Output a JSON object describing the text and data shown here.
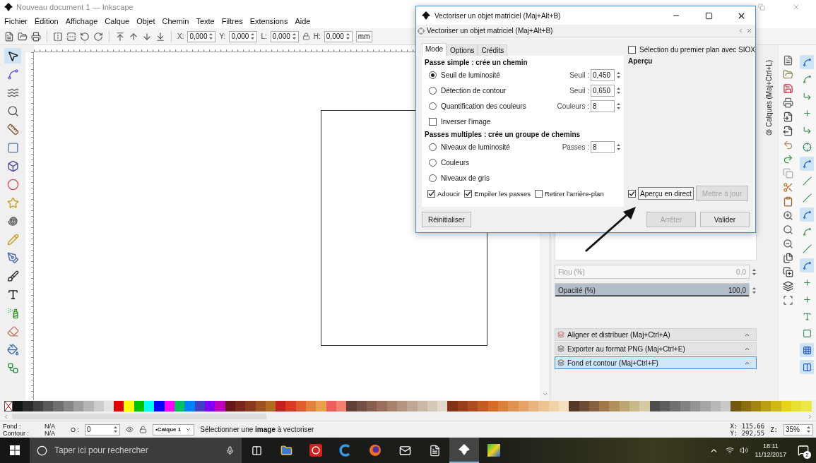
{
  "window": {
    "title": "Nouveau document 1 — Inkscape"
  },
  "menu": [
    "Fichier",
    "Édition",
    "Affichage",
    "Calque",
    "Objet",
    "Chemin",
    "Texte",
    "Filtres",
    "Extensions",
    "Aide"
  ],
  "toolbar": {
    "fields": [
      {
        "label": "X:",
        "value": "0,000"
      },
      {
        "label": "Y:",
        "value": "0,000"
      },
      {
        "label": "L:",
        "value": "0,000"
      },
      {
        "label": "H:",
        "value": "0,000"
      }
    ],
    "unit": "mm"
  },
  "snap_bar": [
    {
      "on": true
    },
    {
      "on": false
    },
    {
      "on": false
    },
    {
      "on": false
    },
    {
      "on": false
    },
    {
      "on": false
    },
    {
      "on": true
    },
    {
      "on": false
    },
    {
      "on": false
    },
    {
      "on": true
    },
    {
      "on": false
    },
    {
      "on": false
    },
    {
      "on": true
    },
    {
      "on": false
    },
    {
      "on": false
    },
    {
      "on": false
    },
    {
      "on": false
    },
    {
      "on": true
    },
    {
      "on": true
    }
  ],
  "dialog": {
    "title": "Vectoriser un objet matriciel (Maj+Alt+B)",
    "header": "Vectoriser un objet matriciel (Maj+Alt+B)",
    "tabs": [
      {
        "label": "Mode",
        "selected": true
      },
      {
        "label": "Options",
        "selected": false
      },
      {
        "label": "Crédits",
        "selected": false
      }
    ],
    "single_pass": {
      "heading": "Passe simple : crée un chemin",
      "options": [
        {
          "label": "Seuil de luminosité",
          "selected": true,
          "field": {
            "label": "Seuil :",
            "value": "0,450"
          }
        },
        {
          "label": "Détection de contour",
          "selected": false,
          "field": {
            "label": "Seuil :",
            "value": "0,650"
          }
        },
        {
          "label": "Quantification des couleurs",
          "selected": false,
          "field": {
            "label": "Couleurs :",
            "value": "8"
          }
        }
      ]
    },
    "invert": {
      "label": "Inverser l'image",
      "checked": false
    },
    "multi_pass": {
      "heading": "Passes multiples : crée un groupe de chemins",
      "options": [
        {
          "label": "Niveaux de luminosité",
          "selected": false,
          "field": {
            "label": "Passes :",
            "value": "8"
          }
        },
        {
          "label": "Couleurs",
          "selected": false
        },
        {
          "label": "Niveaux de gris",
          "selected": false
        }
      ]
    },
    "flags": [
      {
        "label": "Adoucir",
        "checked": true
      },
      {
        "label": "Empiler les passes",
        "checked": true
      },
      {
        "label": "Retirer l'arrière-plan",
        "checked": false
      }
    ],
    "siox": {
      "label": "Sélection du premier plan avec SIOX",
      "checked": false
    },
    "preview_heading": "Aperçu",
    "live_preview": {
      "label": "Aperçu en direct",
      "checked": true
    },
    "update_button": {
      "label": "Mettre à jour",
      "disabled": true
    },
    "reset_button": {
      "label": "Réinitialiser",
      "disabled": false
    },
    "buttons": [
      {
        "label": "Arrêter",
        "disabled": true
      },
      {
        "label": "Valider",
        "disabled": false
      }
    ]
  },
  "dock": {
    "fields": [
      {
        "label": "Flou (%)",
        "value": "0,0",
        "disabled": true
      },
      {
        "label": "Opacité (%)",
        "value": "100,0",
        "disabled": false,
        "level": 1
      }
    ],
    "panels": [
      {
        "label": "Aligner et distribuer (Maj+Ctrl+A)",
        "selected": false
      },
      {
        "label": "Exporter au format PNG (Maj+Ctrl+E)",
        "selected": false
      },
      {
        "label": "Fond et contour (Maj+Ctrl+F)",
        "selected": true
      }
    ],
    "side_tab": "Calques (Maj+Ctrl+L)"
  },
  "status": {
    "fill_label": "Fond :",
    "stroke_label": "Contour :",
    "fill_value": "N/A",
    "stroke_value": "N/A",
    "opacity_label": "O :",
    "opacity_value": "0",
    "layer": "•Calque 1",
    "message": "Sélectionner une **image** à vectoriser",
    "x": "X: 115,66",
    "y": "Y: 292,55",
    "zoom_label": "Z:",
    "zoom": "35%"
  },
  "taskbar": {
    "search_placeholder": "Taper ici pour rechercher",
    "time": "18:11",
    "date": "11/12/2017",
    "notifications": "2"
  }
}
